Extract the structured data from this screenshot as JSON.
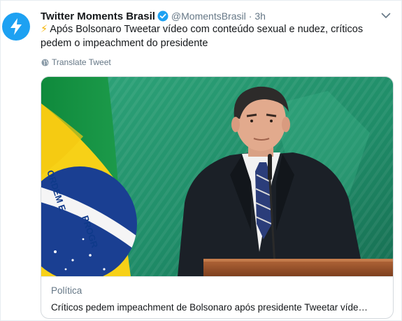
{
  "tweet": {
    "author_name": "Twitter Moments Brasil",
    "handle": "@MomentsBrasil",
    "separator": "·",
    "time": "3h",
    "emoji": "⚡",
    "text": "Após Bolsonaro Tweetar vídeo com conteúdo sexual e nudez, críticos pedem o impeachment do presidente",
    "translate_label": "Translate Tweet"
  },
  "card": {
    "category": "Política",
    "title": "Críticos pedem impeachment de Bolsonaro após presidente Tweetar víde…",
    "flag_motto_left": "ORDEM E",
    "flag_motto_right": "PROGR"
  },
  "colors": {
    "accent": "#1da1f2",
    "text_primary": "#14171a",
    "text_secondary": "#657786",
    "card_border": "#d4d9dd"
  },
  "icons": {
    "avatar": "lightning-bolt-icon",
    "verified": "verified-badge-icon",
    "menu": "chevron-down-icon",
    "translate": "globe-icon"
  }
}
